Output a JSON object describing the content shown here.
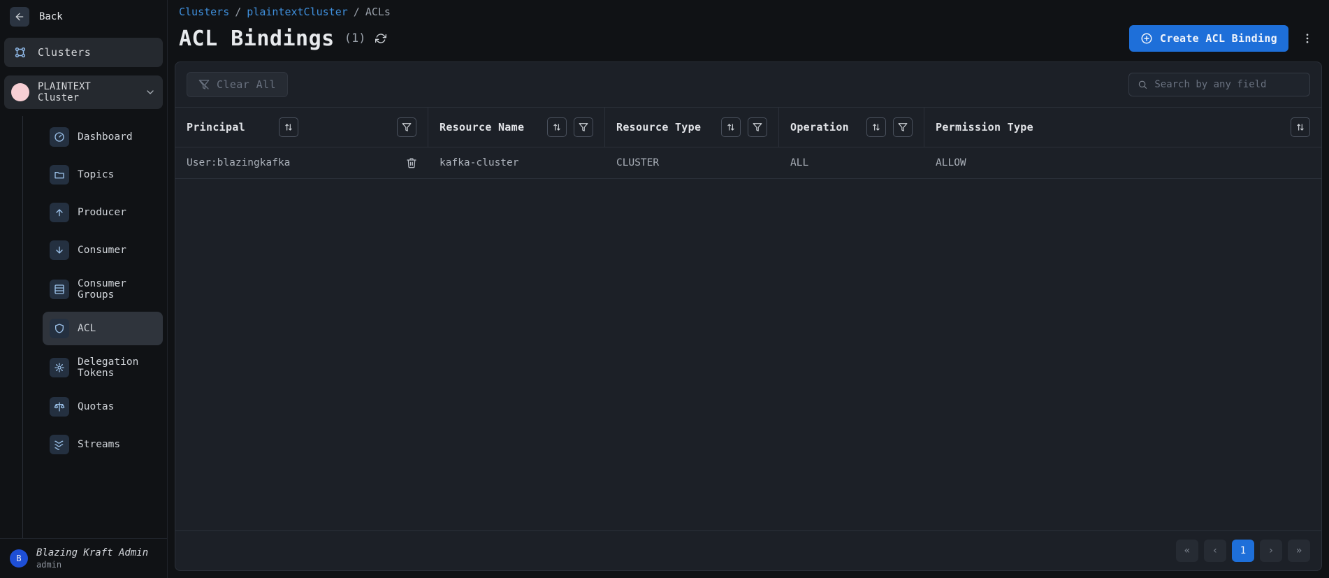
{
  "sidebar": {
    "back_label": "Back",
    "clusters_label": "Clusters",
    "cluster_select_label": "PLAINTEXT Cluster",
    "nav": [
      {
        "label": "Dashboard"
      },
      {
        "label": "Topics"
      },
      {
        "label": "Producer"
      },
      {
        "label": "Consumer"
      },
      {
        "label": "Consumer Groups"
      },
      {
        "label": "ACL"
      },
      {
        "label": "Delegation Tokens"
      },
      {
        "label": "Quotas"
      },
      {
        "label": "Streams"
      }
    ]
  },
  "user": {
    "initial": "B",
    "name": "Blazing Kraft Admin",
    "role": "admin"
  },
  "crumbs": {
    "a": "Clusters",
    "b": "plaintextCluster",
    "c": "ACLs"
  },
  "header": {
    "title": "ACL Bindings",
    "count": "(1)",
    "create_label": "Create ACL Binding"
  },
  "toolbar": {
    "clear_label": "Clear All",
    "search_placeholder": "Search by any field"
  },
  "table": {
    "headers": {
      "principal": "Principal",
      "resource_name": "Resource Name",
      "resource_type": "Resource Type",
      "operation": "Operation",
      "permission_type": "Permission Type"
    },
    "rows": [
      {
        "principal": "User:blazingkafka",
        "resource_name": "kafka-cluster",
        "resource_type": "CLUSTER",
        "operation": "ALL",
        "permission_type": "ALLOW"
      }
    ]
  },
  "pager": {
    "current": "1"
  }
}
